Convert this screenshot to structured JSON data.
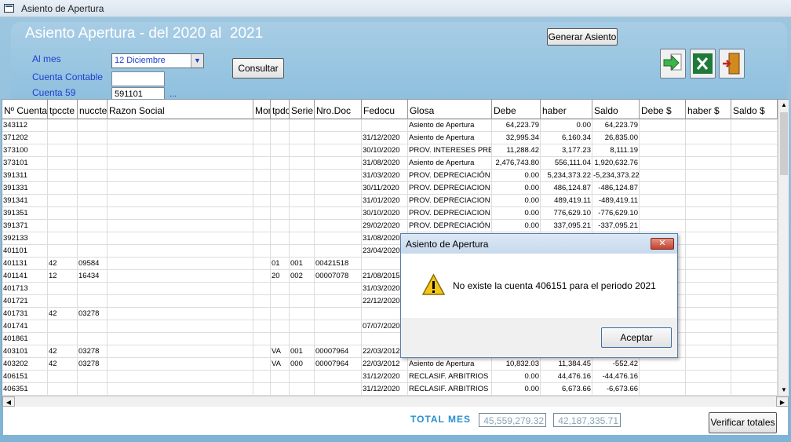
{
  "window": {
    "title": "Asiento de Apertura"
  },
  "header": {
    "title": "Asiento Apertura - del 2020 al  2021",
    "generar_label": "Generar Asiento",
    "consultar_label": "Consultar"
  },
  "form": {
    "al_mes_label": "Al mes",
    "al_mes_value": "12 Diciembre",
    "cuenta_contable_label": "Cuenta Contable",
    "cuenta_contable_value": "",
    "cuenta59_label": "Cuenta 59",
    "cuenta59_value": "591101",
    "ellipsis": "..."
  },
  "icons": [
    "export-arrow-icon",
    "excel-icon",
    "exit-door-icon"
  ],
  "grid": {
    "columns": [
      "Nº Cuenta",
      "tpccte",
      "nuccte",
      "Razon Social",
      "Mon",
      "tpdo",
      "Serie",
      "Nro.Doc",
      "Fedocu",
      "Glosa",
      "Debe",
      "haber",
      "Saldo",
      "Debe $",
      "haber $",
      "Saldo $"
    ],
    "rows": [
      [
        "343112",
        "",
        "",
        "",
        "",
        "",
        "",
        "",
        "",
        "Asiento de Apertura",
        "64,223.79",
        "0.00",
        "64,223.79",
        "",
        "",
        ""
      ],
      [
        "371202",
        "",
        "",
        "",
        "",
        "",
        "",
        "",
        "31/12/2020",
        "Asiento de Apertura",
        "32,995.34",
        "6,160.34",
        "26,835.00",
        "",
        "",
        ""
      ],
      [
        "373100",
        "",
        "",
        "",
        "",
        "",
        "",
        "",
        "30/10/2020",
        "PROV. INTERESES PRE",
        "11,288.42",
        "3,177.23",
        "8,111.19",
        "",
        "",
        ""
      ],
      [
        "373101",
        "",
        "",
        "",
        "",
        "",
        "",
        "",
        "31/08/2020",
        "Asiento de Apertura",
        "2,476,743.80",
        "556,111.04",
        "1,920,632.76",
        "",
        "",
        ""
      ],
      [
        "391311",
        "",
        "",
        "",
        "",
        "",
        "",
        "",
        "31/03/2020",
        "PROV. DEPRECIACIÓN",
        "0.00",
        "5,234,373.22",
        "-5,234,373.22",
        "",
        "",
        ""
      ],
      [
        "391331",
        "",
        "",
        "",
        "",
        "",
        "",
        "",
        "30/11/2020",
        "PROV. DEPRECIACION",
        "0.00",
        "486,124.87",
        "-486,124.87",
        "",
        "",
        ""
      ],
      [
        "391341",
        "",
        "",
        "",
        "",
        "",
        "",
        "",
        "31/01/2020",
        "PROV. DEPRECIACION",
        "0.00",
        "489,419.11",
        "-489,419.11",
        "",
        "",
        ""
      ],
      [
        "391351",
        "",
        "",
        "",
        "",
        "",
        "",
        "",
        "30/10/2020",
        "PROV. DEPRECIACION",
        "0.00",
        "776,629.10",
        "-776,629.10",
        "",
        "",
        ""
      ],
      [
        "391371",
        "",
        "",
        "",
        "",
        "",
        "",
        "",
        "29/02/2020",
        "PROV. DEPRECIACIÓN",
        "0.00",
        "337,095.21",
        "-337,095.21",
        "",
        "",
        ""
      ],
      [
        "392133",
        "",
        "",
        "",
        "",
        "",
        "",
        "",
        "31/08/2020",
        "",
        "",
        "",
        "",
        "",
        "",
        ""
      ],
      [
        "401101",
        "",
        "",
        "",
        "",
        "",
        "",
        "",
        "23/04/2020",
        "",
        "",
        "",
        "",
        "",
        "",
        ""
      ],
      [
        "401131",
        "42",
        "09584",
        "",
        "",
        "01",
        "001",
        "00421518",
        "",
        "",
        "",
        "",
        "",
        "",
        "",
        ""
      ],
      [
        "401141",
        "12",
        "16434",
        "",
        "",
        "20",
        "002",
        "00007078",
        "21/08/2015",
        "",
        "",
        "",
        "",
        "",
        "",
        ""
      ],
      [
        "401713",
        "",
        "",
        "",
        "",
        "",
        "",
        "",
        "31/03/2020",
        "",
        "",
        "",
        "",
        "",
        "",
        ""
      ],
      [
        "401721",
        "",
        "",
        "",
        "",
        "",
        "",
        "",
        "22/12/2020",
        "",
        "",
        "",
        "",
        "",
        "",
        ""
      ],
      [
        "401731",
        "42",
        "03278",
        "",
        "",
        "",
        "",
        "",
        "",
        "",
        "",
        "",
        "",
        "",
        "",
        ""
      ],
      [
        "401741",
        "",
        "",
        "",
        "",
        "",
        "",
        "",
        "07/07/2020",
        "",
        "",
        "",
        "",
        "",
        "",
        ""
      ],
      [
        "401861",
        "",
        "",
        "",
        "",
        "",
        "",
        "",
        "",
        "",
        "",
        "",
        "",
        "",
        "",
        ""
      ],
      [
        "403101",
        "42",
        "03278",
        "",
        "",
        "VA",
        "001",
        "00007964",
        "22/03/2012",
        "",
        "",
        "",
        "",
        "",
        "",
        ""
      ],
      [
        "403202",
        "42",
        "03278",
        "",
        "",
        "VA",
        "000",
        "00007964",
        "22/03/2012",
        "Asiento de Apertura",
        "10,832.03",
        "11,384.45",
        "-552.42",
        "",
        "",
        ""
      ],
      [
        "406151",
        "",
        "",
        "",
        "",
        "",
        "",
        "",
        "31/12/2020",
        "RECLASIF. ARBITRIOS",
        "0.00",
        "44,476.16",
        "-44,476.16",
        "",
        "",
        ""
      ],
      [
        "406351",
        "",
        "",
        "",
        "",
        "",
        "",
        "",
        "31/12/2020",
        "RECLASIF. ARBITRIOS",
        "0.00",
        "6,673.66",
        "-6,673.66",
        "",
        "",
        ""
      ]
    ]
  },
  "footer": {
    "total_label": "TOTAL MES",
    "total_debe": "45,559,279.32",
    "total_haber": "42,187,335.71",
    "verificar_label": "Verificar totales"
  },
  "dialog": {
    "title": "Asiento de Apertura",
    "message": "No existe la cuenta 406151 para el periodo 2021",
    "ok_label": "Aceptar",
    "close": "✕"
  }
}
